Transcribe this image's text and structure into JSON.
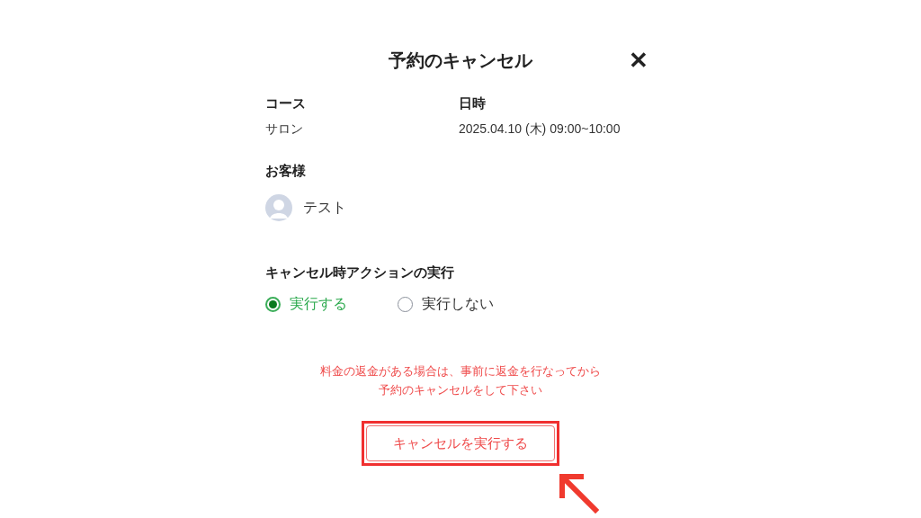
{
  "dialog": {
    "title": "予約のキャンセル",
    "close": "✕"
  },
  "details": [
    {
      "label": "コース",
      "value": "サロン"
    },
    {
      "label": "日時",
      "value": "2025.04.10 (木) 09:00~10:00"
    }
  ],
  "customer": {
    "label": "お客様",
    "name": "テスト"
  },
  "action": {
    "label": "キャンセル時アクションの実行",
    "options": [
      {
        "label": "実行する",
        "selected": true
      },
      {
        "label": "実行しない",
        "selected": false
      }
    ]
  },
  "notice": [
    "料金の返金がある場合は、事前に返金を行なってから",
    "予約のキャンセルをして下さい"
  ],
  "submit": {
    "label": "キャンセルを実行する",
    "highlighted": true
  }
}
